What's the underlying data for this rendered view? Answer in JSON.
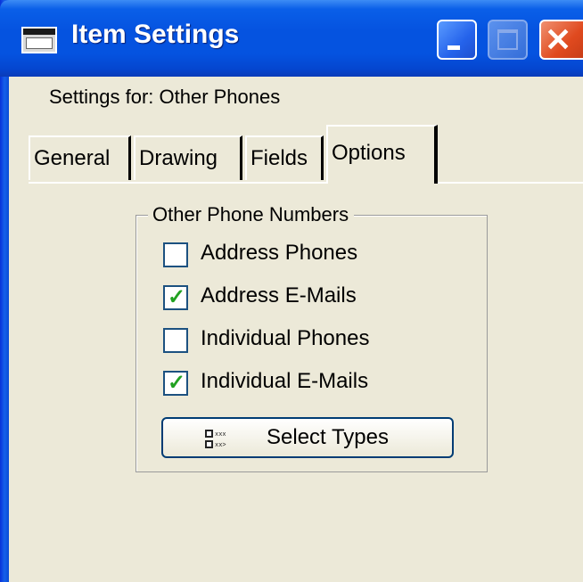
{
  "window": {
    "title": "Item Settings",
    "controls": {
      "minimize": "minimize-icon",
      "maximize": "maximize-icon",
      "close": "close-icon"
    }
  },
  "header": {
    "settings_line": "Settings for:  Other Phones"
  },
  "tabs": [
    {
      "label": "General",
      "active": false
    },
    {
      "label": "Drawing",
      "active": false
    },
    {
      "label": "Fields",
      "active": false
    },
    {
      "label": "Options",
      "active": true
    }
  ],
  "group": {
    "legend": "Other Phone Numbers",
    "checkboxes": [
      {
        "label": "Address Phones",
        "checked": false
      },
      {
        "label": "Address E-Mails",
        "checked": true
      },
      {
        "label": "Individual Phones",
        "checked": false
      },
      {
        "label": "Individual E-Mails",
        "checked": true
      }
    ],
    "button": {
      "label": "Select Types",
      "icon": "phone-types-icon"
    }
  },
  "colors": {
    "titlebar": "#0553e0",
    "dialog_bg": "#ece9d8",
    "check": "#21a121",
    "close_button": "#e04a1f"
  }
}
